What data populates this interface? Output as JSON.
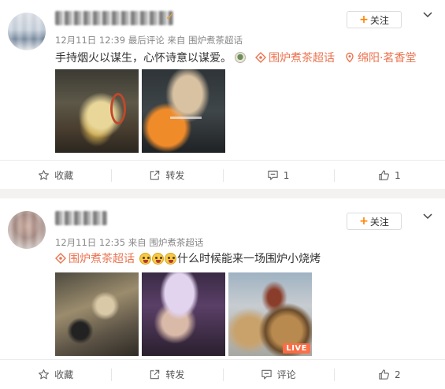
{
  "posts": [
    {
      "username": "",
      "meta": "12月11日 12:39 最后评论 来自 围炉煮茶超话",
      "follow_label": "关注",
      "text": "手持烟火以谋生，心怀诗意以谋爱。",
      "topic": "围炉煮茶超话",
      "location": "绵阳·茗香堂",
      "actions": {
        "favorite": "收藏",
        "repost": "转发",
        "comment": "1",
        "like": "1"
      }
    },
    {
      "username": "",
      "meta": "12月11日 12:35 来自 围炉煮茶超话",
      "follow_label": "关注",
      "topic": "围炉煮茶超话",
      "text": "什么时候能来一场围炉小烧烤",
      "live_badge": "LIVE",
      "actions": {
        "favorite": "收藏",
        "repost": "转发",
        "comment": "评论",
        "like": "2"
      }
    }
  ],
  "icons": {
    "follow_plus": "plus-icon",
    "more": "chevron-down-icon",
    "topic": "topic-hash-icon",
    "location": "location-pin-icon",
    "favorite": "star-icon",
    "repost": "share-arrow-icon",
    "comment": "comment-bubble-icon",
    "like": "thumbs-up-icon"
  },
  "colors": {
    "accent": "#ff8200",
    "topic": "#eb7350",
    "meta": "#888888"
  }
}
